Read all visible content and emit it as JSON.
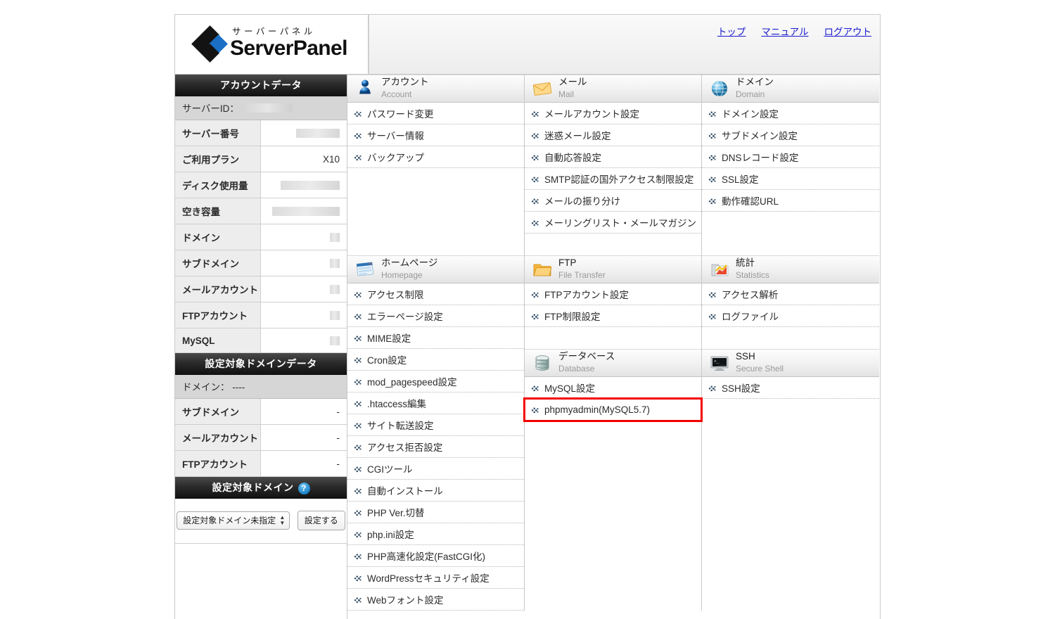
{
  "brand": {
    "kana": "サーバーパネル",
    "name": "ServerPanel"
  },
  "topnav": [
    {
      "label": "トップ",
      "name": "top"
    },
    {
      "label": "マニュアル",
      "name": "manual"
    },
    {
      "label": "ログアウト",
      "name": "logout"
    }
  ],
  "sidebar": {
    "account_data_title": "アカウントデータ",
    "server_id_label": "サーバーID：",
    "server_id_value": "",
    "account_rows": [
      {
        "key": "サーバー番号",
        "value": "",
        "redacted": true,
        "redact_w": 62
      },
      {
        "key": "ご利用プラン",
        "value": "X10",
        "redacted": false,
        "redact_w": 0
      },
      {
        "key": "ディスク使用量",
        "value": "",
        "redacted": true,
        "redact_w": 84
      },
      {
        "key": "空き容量",
        "value": "",
        "redacted": true,
        "redact_w": 96
      },
      {
        "key": "ドメイン",
        "value": "",
        "redacted": true,
        "redact_w": 14
      },
      {
        "key": "サブドメイン",
        "value": "",
        "redacted": true,
        "redact_w": 14
      },
      {
        "key": "メールアカウント",
        "value": "",
        "redacted": true,
        "redact_w": 14
      },
      {
        "key": "FTPアカウント",
        "value": "",
        "redacted": true,
        "redact_w": 14
      },
      {
        "key": "MySQL",
        "value": "",
        "redacted": true,
        "redact_w": 14
      }
    ],
    "target_domain_data_title": "設定対象ドメインデータ",
    "target_domain_label": "ドメイン：  ----",
    "target_rows": [
      {
        "key": "サブドメイン",
        "value": "-"
      },
      {
        "key": "メールアカウント",
        "value": "-"
      },
      {
        "key": "FTPアカウント",
        "value": "-"
      }
    ],
    "target_domain_title": "設定対象ドメイン",
    "help_badge": "?",
    "select_value": "設定対象ドメイン未指定",
    "set_button": "設定する"
  },
  "sections": [
    {
      "id": "account",
      "jp": "アカウント",
      "en": "Account",
      "icon": "user-icon",
      "items": [
        {
          "label": "パスワード変更"
        },
        {
          "label": "サーバー情報"
        },
        {
          "label": "バックアップ"
        }
      ],
      "blank_rows": 4
    },
    {
      "id": "mail",
      "jp": "メール",
      "en": "Mail",
      "icon": "envelope-icon",
      "items": [
        {
          "label": "メールアカウント設定"
        },
        {
          "label": "迷惑メール設定"
        },
        {
          "label": "自動応答設定"
        },
        {
          "label": "SMTP認証の国外アクセス制限設定"
        },
        {
          "label": "メールの振り分け"
        },
        {
          "label": "メーリングリスト・メールマガジン"
        }
      ],
      "blank_rows": 1
    },
    {
      "id": "domain",
      "jp": "ドメイン",
      "en": "Domain",
      "icon": "globe-icon",
      "items": [
        {
          "label": "ドメイン設定"
        },
        {
          "label": "サブドメイン設定"
        },
        {
          "label": "DNSレコード設定"
        },
        {
          "label": "SSL設定"
        },
        {
          "label": "動作確認URL"
        }
      ],
      "blank_rows": 2
    },
    {
      "id": "homepage",
      "jp": "ホームページ",
      "en": "Homepage",
      "icon": "webpage-icon",
      "items": [
        {
          "label": "アクセス制限"
        },
        {
          "label": "エラーページ設定"
        },
        {
          "label": "MIME設定"
        },
        {
          "label": "Cron設定"
        },
        {
          "label": "mod_pagespeed設定"
        },
        {
          "label": ".htaccess編集"
        },
        {
          "label": "サイト転送設定"
        },
        {
          "label": "アクセス拒否設定"
        },
        {
          "label": "CGIツール"
        },
        {
          "label": "自動インストール"
        },
        {
          "label": "PHP Ver.切替"
        },
        {
          "label": "php.ini設定"
        },
        {
          "label": "PHP高速化設定(FastCGI化)"
        },
        {
          "label": "WordPressセキュリティ設定"
        },
        {
          "label": "Webフォント設定"
        }
      ],
      "blank_rows": 0
    },
    {
      "id": "ftp",
      "jp": "FTP",
      "en": "File Transfer",
      "icon": "folder-icon",
      "items": [
        {
          "label": "FTPアカウント設定"
        },
        {
          "label": "FTP制限設定"
        }
      ],
      "blank_rows": 1
    },
    {
      "id": "statistics",
      "jp": "統計",
      "en": "Statistics",
      "icon": "chart-icon",
      "items": [
        {
          "label": "アクセス解析"
        },
        {
          "label": "ログファイル"
        }
      ],
      "blank_rows": 1
    },
    {
      "id": "database",
      "jp": "データベース",
      "en": "Database",
      "icon": "database-icon",
      "items": [
        {
          "label": "MySQL設定",
          "highlighted": false
        },
        {
          "label": "phpmyadmin(MySQL5.7)",
          "highlighted": true
        }
      ],
      "blank_rows": 0
    },
    {
      "id": "ssh",
      "jp": "SSH",
      "en": "Secure Shell",
      "icon": "terminal-icon",
      "items": [
        {
          "label": "SSH設定",
          "highlighted": false
        }
      ],
      "blank_rows": 0
    }
  ],
  "colors": {
    "link": "#1a1ad0",
    "highlight": "#f60000",
    "header_bar_dark": "#111111",
    "accent_blue": "#1b6fc4"
  }
}
